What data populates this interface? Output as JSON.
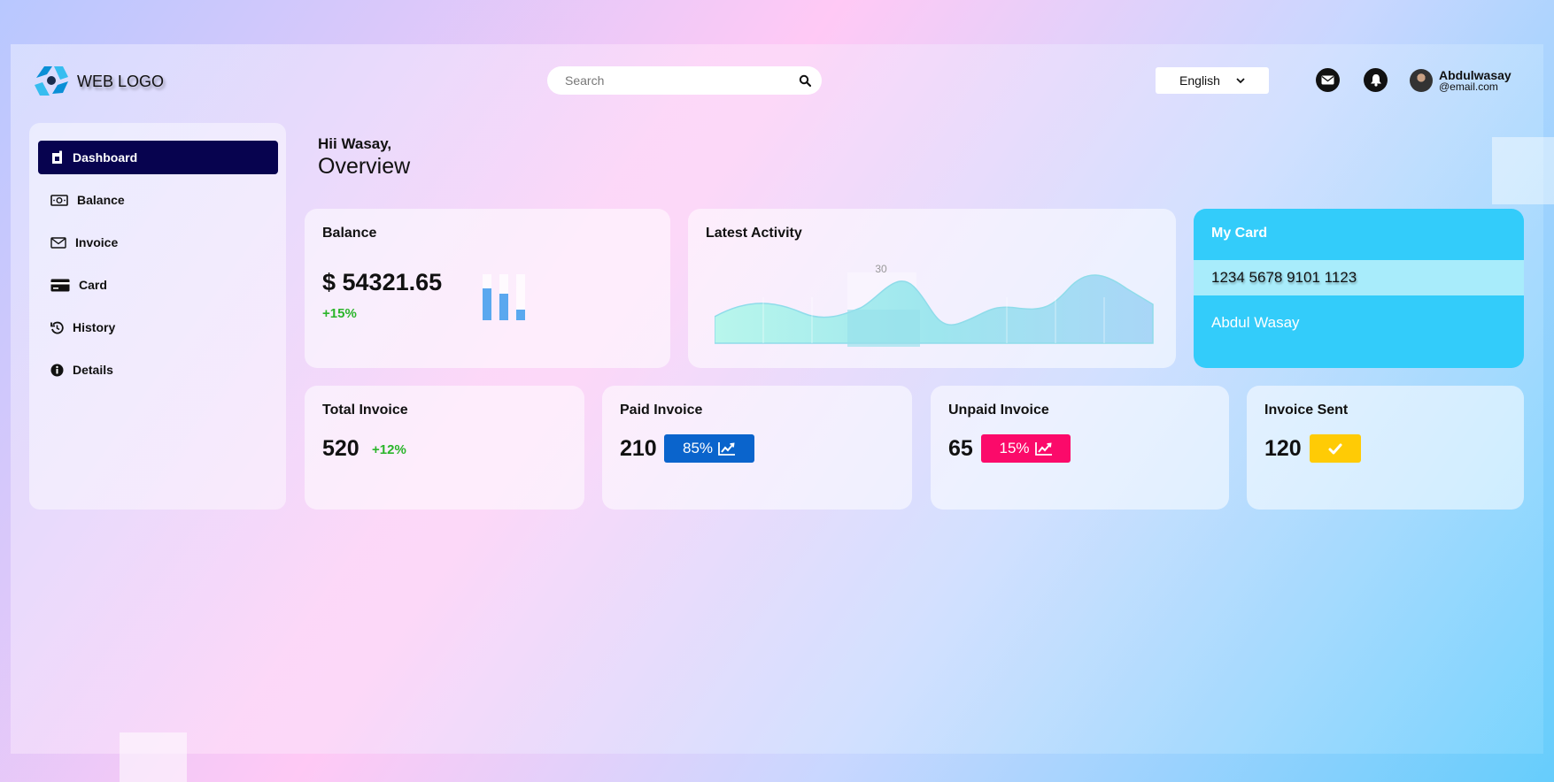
{
  "header": {
    "logo_text": "WEB LOGO",
    "search_placeholder": "Search",
    "language": "English",
    "user_name": "Abdulwasay",
    "user_email": "@email.com"
  },
  "sidebar": {
    "items": [
      {
        "label": "Dashboard",
        "icon": "dashboard-icon",
        "active": true
      },
      {
        "label": "Balance",
        "icon": "money-icon",
        "active": false
      },
      {
        "label": "Invoice",
        "icon": "envelope-icon",
        "active": false
      },
      {
        "label": "Card",
        "icon": "credit-card-icon",
        "active": false
      },
      {
        "label": "History",
        "icon": "history-icon",
        "active": false
      },
      {
        "label": "Details",
        "icon": "info-icon",
        "active": false
      }
    ]
  },
  "main": {
    "greeting": "Hii Wasay,",
    "title": "Overview"
  },
  "balance": {
    "title": "Balance",
    "amount": "$ 54321.65",
    "change": "+15%"
  },
  "activity": {
    "title": "Latest Activity",
    "tooltip_value": "30"
  },
  "my_card": {
    "title": "My Card",
    "number": "1234 5678 9101 1123",
    "holder": "Abdul Wasay"
  },
  "stats": {
    "total": {
      "title": "Total Invoice",
      "value": "520",
      "change": "+12%"
    },
    "paid": {
      "title": "Paid Invoice",
      "value": "210",
      "badge": "85%",
      "badge_color": "#0a64cc"
    },
    "unpaid": {
      "title": "Unpaid Invoice",
      "value": "65",
      "badge": "15%",
      "badge_color": "#fb0a6a"
    },
    "sent": {
      "title": "Invoice Sent",
      "value": "120",
      "badge_color": "#ffcb05"
    }
  },
  "colors": {
    "sidebar_active": "#07034f",
    "card_accent": "#33ccfa",
    "positive": "#2bb52b"
  }
}
